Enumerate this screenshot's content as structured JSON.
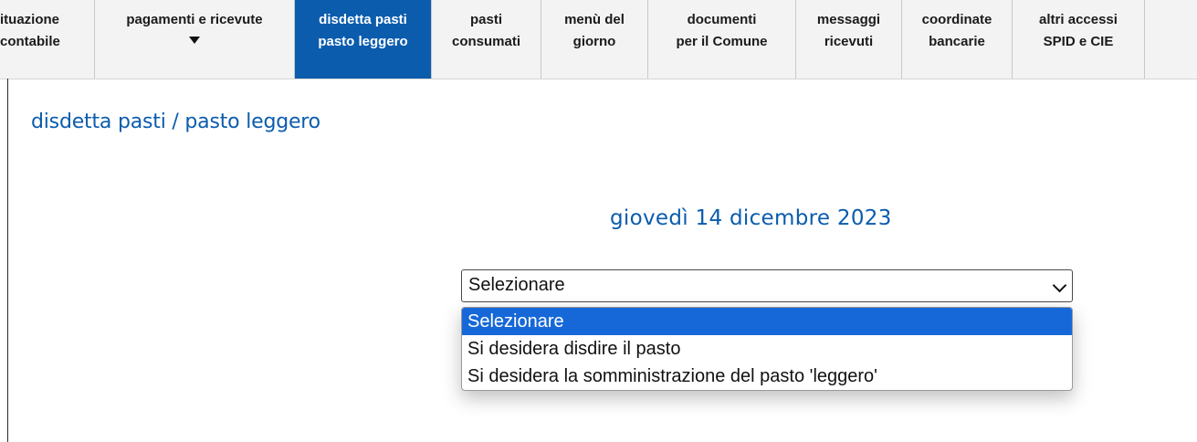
{
  "nav": {
    "items": [
      {
        "line1": "ituazione",
        "line2": "contabile",
        "active": false
      },
      {
        "line1": "pagamenti e ricevute",
        "line2": "",
        "active": false,
        "has_arrow": true
      },
      {
        "line1": "disdetta pasti",
        "line2": "pasto leggero",
        "active": true
      },
      {
        "line1": "pasti",
        "line2": "consumati",
        "active": false
      },
      {
        "line1": "menù del",
        "line2": "giorno",
        "active": false
      },
      {
        "line1": "documenti",
        "line2": "per il Comune",
        "active": false
      },
      {
        "line1": "messaggi",
        "line2": "ricevuti",
        "active": false
      },
      {
        "line1": "coordinate",
        "line2": "bancarie",
        "active": false
      },
      {
        "line1": "altri accessi",
        "line2": "SPID e CIE",
        "active": false
      }
    ]
  },
  "page": {
    "title": "disdetta pasti / pasto leggero",
    "date": "giovedì 14 dicembre 2023"
  },
  "select": {
    "value": "Selezionare",
    "options": [
      {
        "label": "Selezionare",
        "selected": true
      },
      {
        "label": "Si desidera disdire il pasto",
        "selected": false
      },
      {
        "label": "Si desidera la somministrazione del pasto 'leggero'",
        "selected": false
      }
    ]
  },
  "colors": {
    "accent": "#0b5cad",
    "selected_option": "#1668d8"
  }
}
